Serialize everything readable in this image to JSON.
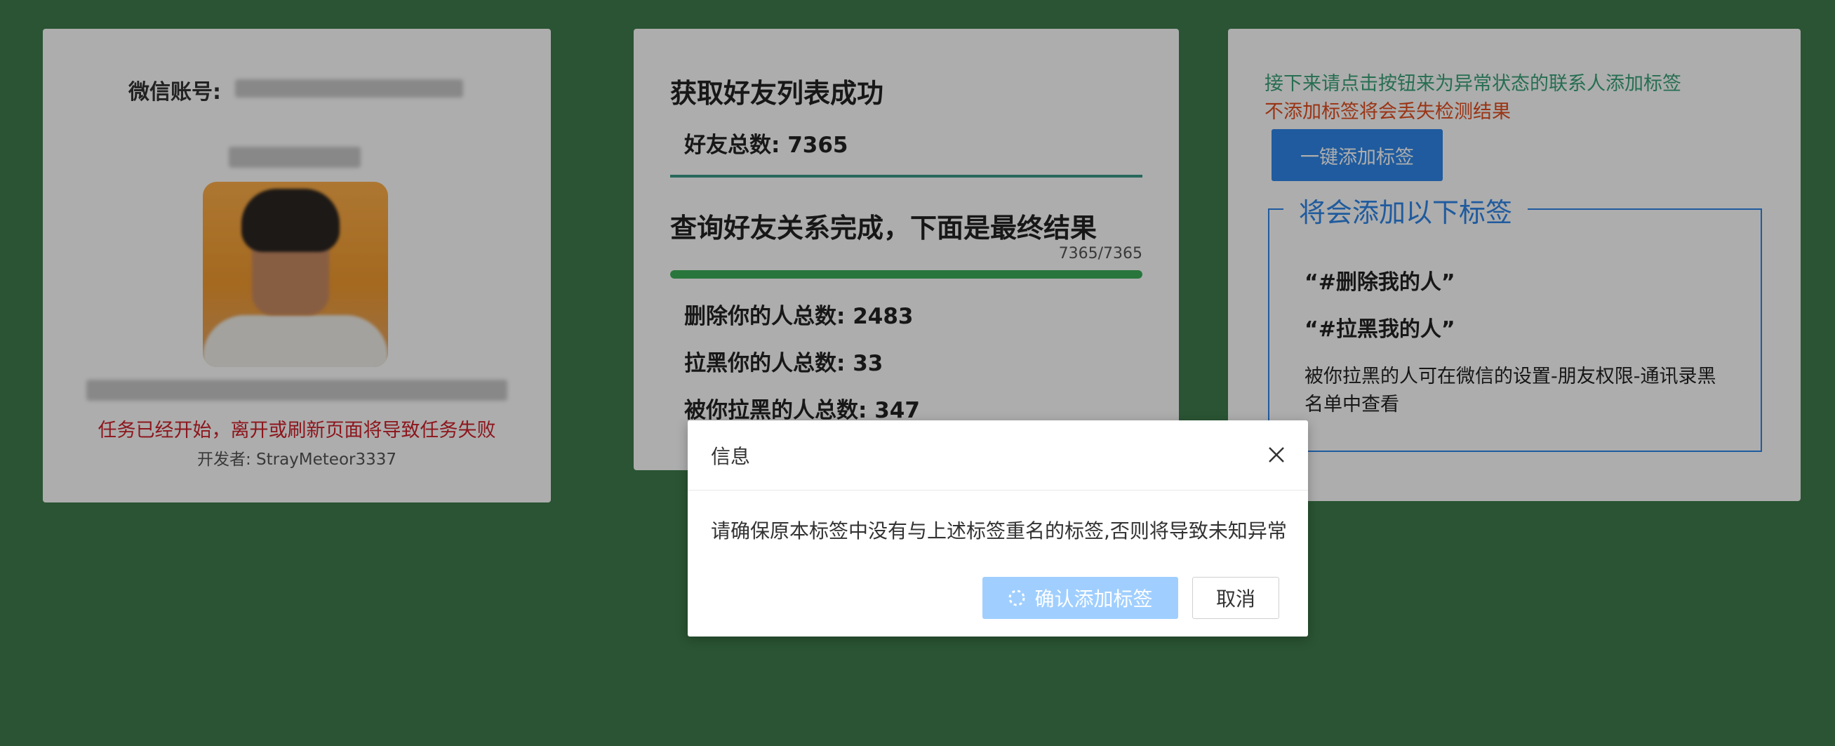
{
  "left_card": {
    "account_label": "微信账号:",
    "warning": "任务已经开始，离开或刷新页面将导致任务失败",
    "developer": "开发者: StrayMeteor3337"
  },
  "middle_card": {
    "title_friends": "获取好友列表成功",
    "friends_total": "好友总数: 7365",
    "title_result": "查询好友关系完成，下面是最终结果",
    "progress_text": "7365/7365",
    "progress_fraction": 1.0,
    "deleted_count": "删除你的人总数: 2483",
    "blocked_you_count": "拉黑你的人总数: 33",
    "blocked_by_you_count": "被你拉黑的人总数: 347"
  },
  "right_card": {
    "tip_line1": "接下来请点击按钮来为异常状态的联系人添加标签",
    "tip_line2": "不添加标签将会丢失检测结果",
    "add_button": "一键添加标签",
    "legend": "将会添加以下标签",
    "tag1": "“#删除我的人”",
    "tag2": "“#拉黑我的人”",
    "note": "被你拉黑的人可在微信的设置-朋友权限-通讯录黑名单中查看"
  },
  "dialog": {
    "title": "信息",
    "message": "请确保原本标签中没有与上述标签重名的标签,否则将导致未知异常",
    "confirm_button": "确认添加标签",
    "cancel_button": "取消",
    "close_icon": "close-icon",
    "spinner_icon": "loading-spinner-icon"
  },
  "colors": {
    "background": "#3f7c4c",
    "primary": "#2f86e9",
    "danger": "#d0212b",
    "success": "#3cae57",
    "tip_green": "#3aa37a",
    "tip_orange": "#e34d1e"
  }
}
